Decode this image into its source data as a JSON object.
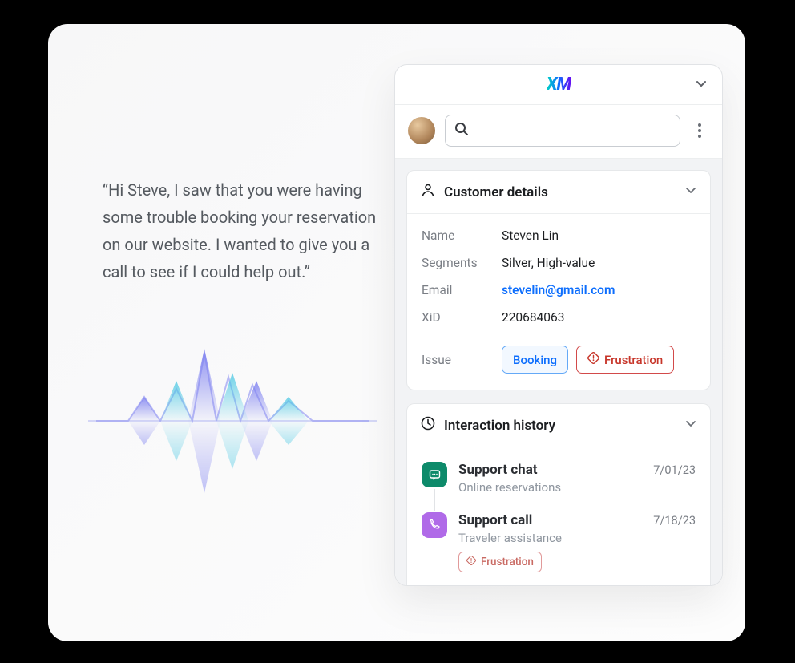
{
  "quote": "“Hi Steve, I saw that you were having some trouble booking your reservation on our website. I wanted to give you a call to see if I could help out.”",
  "logo": "XM",
  "customer_details": {
    "heading": "Customer details",
    "labels": {
      "name": "Name",
      "segments": "Segments",
      "email": "Email",
      "xid": "XiD",
      "issue": "Issue"
    },
    "name": "Steven Lin",
    "segments": "Silver, High-value",
    "email": "stevelin@gmail.com",
    "xid": "220684063",
    "issue_tags": {
      "booking": "Booking",
      "frustration": "Frustration"
    }
  },
  "interaction_history": {
    "heading": "Interaction history",
    "items": [
      {
        "title": "Support chat",
        "subtitle": "Online reservations",
        "date": "7/01/23"
      },
      {
        "title": "Support call",
        "subtitle": "Traveler assistance",
        "date": "7/18/23",
        "tag": "Frustration"
      }
    ]
  }
}
